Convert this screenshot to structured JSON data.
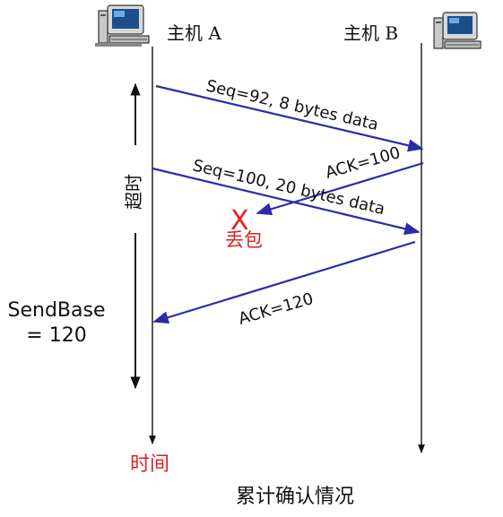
{
  "hosts": {
    "a": {
      "label": "主机 A",
      "icon": "computer-icon"
    },
    "b": {
      "label": "主机 B",
      "icon": "computer-icon"
    }
  },
  "messages": [
    {
      "id": "seg1",
      "from": "A",
      "to": "B",
      "label": "Seq=92, 8 bytes data",
      "color": "#2b2ba8"
    },
    {
      "id": "ack1",
      "from": "B",
      "to": "A",
      "label": "ACK=100",
      "lost": true,
      "color": "#2b2ba8"
    },
    {
      "id": "seg2",
      "from": "A",
      "to": "B",
      "label": "Seq=100, 20 bytes data",
      "color": "#2b2ba8"
    },
    {
      "id": "ack2",
      "from": "B",
      "to": "A",
      "label": "ACK=120",
      "color": "#2b2ba8"
    }
  ],
  "loss": {
    "mark": "X",
    "label": "丢包",
    "color": "#e02020"
  },
  "timeout": {
    "label": "超时"
  },
  "sendbase": {
    "line1": "SendBase",
    "line2": "= 120"
  },
  "time_label": {
    "text": "时间",
    "color": "#e02020"
  },
  "caption": "累计确认情况"
}
